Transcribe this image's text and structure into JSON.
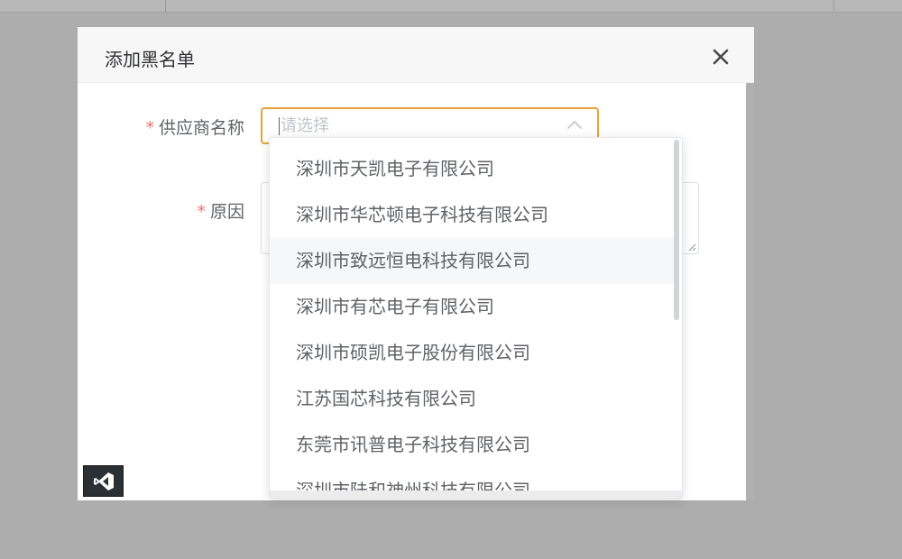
{
  "dialog": {
    "title": "添加黑名单"
  },
  "form": {
    "supplier": {
      "required_mark": "*",
      "label": "供应商名称",
      "placeholder": "请选择"
    },
    "reason": {
      "required_mark": "*",
      "label": "原因"
    }
  },
  "dropdown": {
    "options": [
      "深圳市天凯电子有限公司",
      "深圳市华芯顿电子科技有限公司",
      "深圳市致远恒电科技有限公司",
      "深圳市有芯电子有限公司",
      "深圳市硕凯电子股份有限公司",
      "江苏国芯科技有限公司",
      "东莞市讯普电子科技有限公司",
      "深圳市陆和神州科技有限公司"
    ],
    "hovered_index": 2
  },
  "colors": {
    "accent_focus": "#e6a23c",
    "required": "#f56c6c",
    "hover_bg": "#f5f7fa"
  },
  "icons": {
    "close": "close-icon",
    "arrow": "chevron-up-icon",
    "logo": "visual-studio-icon"
  }
}
